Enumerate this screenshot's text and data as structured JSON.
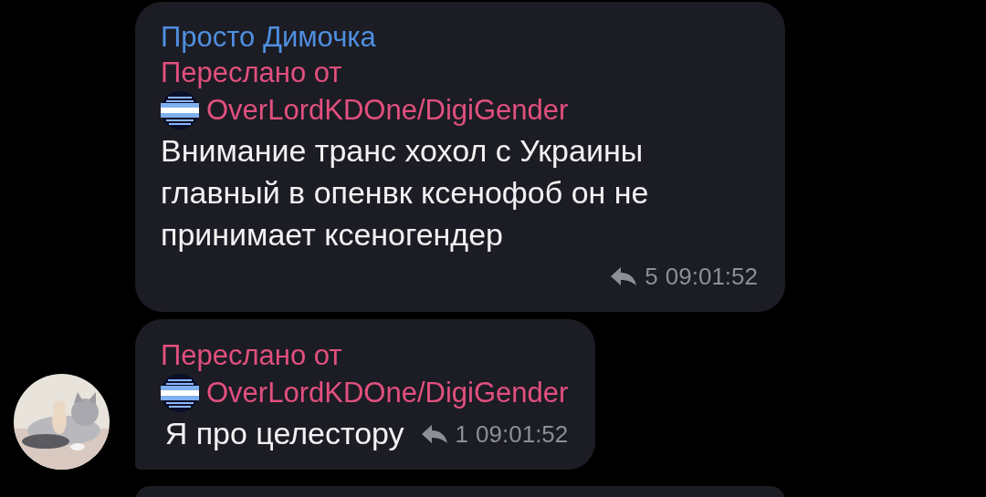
{
  "messages": [
    {
      "kind": "message",
      "avatar": false,
      "sender": "Просто Димочка",
      "forwarded_label": "Переслано от",
      "forwarded_from": "OverLordKDOne/DigiGender",
      "text": "Внимание транс хохол с Украины главный в опенвк ксенофоб он не принимает ксеногендер",
      "replies": "5",
      "time": "09:01:52"
    },
    {
      "kind": "message",
      "avatar": true,
      "forwarded_label": "Переслано от",
      "forwarded_from": "OverLordKDOne/DigiGender",
      "text": "Я про целестору",
      "replies": "1",
      "time": "09:01:52"
    },
    {
      "kind": "partial"
    }
  ]
}
